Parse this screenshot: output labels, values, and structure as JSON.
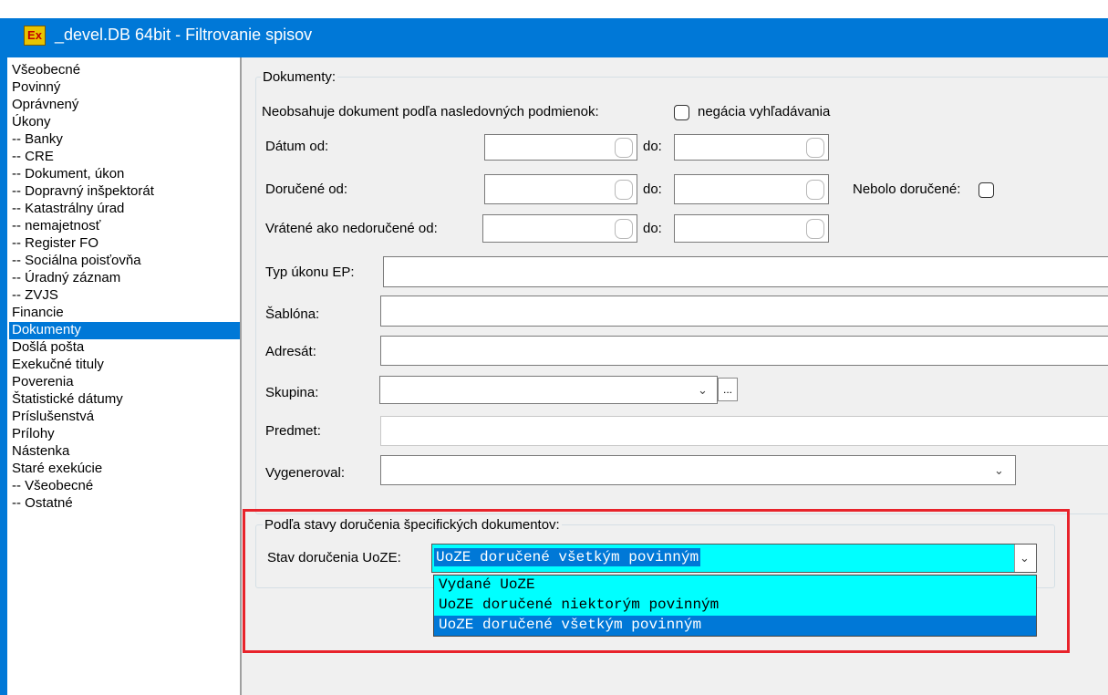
{
  "window": {
    "title": "_devel.DB 64bit - Filtrovanie spisov",
    "icon_text": "Ex"
  },
  "nav": {
    "items": [
      "Všeobecné",
      "Povinný",
      "Oprávnený",
      "Úkony",
      "-- Banky",
      "-- CRE",
      "-- Dokument, úkon",
      "-- Dopravný inšpektorát",
      "-- Katastrálny úrad",
      "-- nemajetnosť",
      "-- Register FO",
      "-- Sociálna poisťovňa",
      "-- Úradný záznam",
      "-- ZVJS",
      "Financie",
      "Dokumenty",
      "Došlá pošta",
      "Exekučné tituly",
      "Poverenia",
      "Štatistické dátumy",
      "Príslušenstvá",
      "Prílohy",
      "Nástenka",
      "Staré exekúcie",
      "-- Všeobecné",
      "-- Ostatné"
    ],
    "selected": "Dokumenty"
  },
  "documents": {
    "group_title": "Dokumenty:",
    "not_contains_label": "Neobsahuje dokument podľa nasledovných podmienok:",
    "negation_label": "negácia vyhľadávania",
    "negation_checked": false,
    "date_from_label": "Dátum od:",
    "date_from_value": "",
    "date_to_label": "do:",
    "date_to_value": "",
    "delivered_from_label": "Doručené od:",
    "delivered_from_value": "",
    "delivered_to_label": "do:",
    "delivered_to_value": "",
    "not_delivered_label": "Nebolo doručené:",
    "not_delivered_checked": false,
    "returned_from_label": "Vrátené ako nedoručené od:",
    "returned_from_value": "",
    "returned_to_label": "do:",
    "returned_to_value": "",
    "ep_type_label": "Typ úkonu EP:",
    "ep_type_value": "",
    "template_label": "Šablóna:",
    "template_value": "",
    "addressee_label": "Adresát:",
    "addressee_value": "",
    "group_label": "Skupina:",
    "group_value": "",
    "group_button_label": "...",
    "subject_label": "Predmet:",
    "subject_value": "",
    "generated_by_label": "Vygeneroval:",
    "generated_by_value": ""
  },
  "delivery": {
    "group_title": "Podľa stavy doručenia špecifických dokumentov:",
    "state_label": "Stav doručenia UoZE:",
    "selected_value": "UoZE doručené všetkým povinným",
    "options": [
      "Vydané UoZE",
      "UoZE doručené niektorým povinným",
      "UoZE doručené všetkým povinným"
    ],
    "highlighted_option": "UoZE doručené všetkým povinným"
  },
  "colors": {
    "titlebar": "#0078d7",
    "selection": "#0078d7",
    "dropdown_bg": "#00ffff",
    "highlight_box": "#e8232b"
  },
  "icons": {
    "chevron": "chevron-down-icon"
  }
}
